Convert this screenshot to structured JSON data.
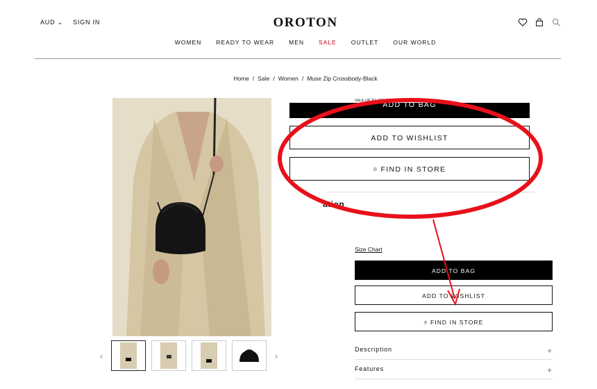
{
  "header": {
    "currency": "AUD",
    "sign_in": "SIGN IN",
    "logo": "OROTON",
    "icons": [
      "heart-icon",
      "bag-icon",
      "search-icon"
    ]
  },
  "nav": {
    "items": [
      {
        "label": "WOMEN"
      },
      {
        "label": "READY TO WEAR"
      },
      {
        "label": "MEN"
      },
      {
        "label": "SALE"
      },
      {
        "label": "OUTLET"
      },
      {
        "label": "OUR WORLD"
      }
    ]
  },
  "breadcrumb": {
    "home": "Home",
    "sale": "Sale",
    "women": "Women",
    "current": "Muse Zip Crossbody-Black",
    "separator": "/"
  },
  "zoom": {
    "sale_note": "SALE UP TO 30% OFF RRP",
    "add_to_bag_partial": "ADD TO BAG",
    "add_to_wishlist": "ADD TO WISHLIST",
    "find_in_store": "FIND IN STORE",
    "section_partial": "ation"
  },
  "product": {
    "size_chart": "Size Chart",
    "add_to_bag": "ADD TO BAG",
    "add_to_wishlist": "ADD TO WISHLIST",
    "find_in_store": "FIND IN STORE",
    "accordion": [
      {
        "label": "Description"
      },
      {
        "label": "Features"
      }
    ]
  },
  "annotation": {
    "color": "#e8101b"
  }
}
